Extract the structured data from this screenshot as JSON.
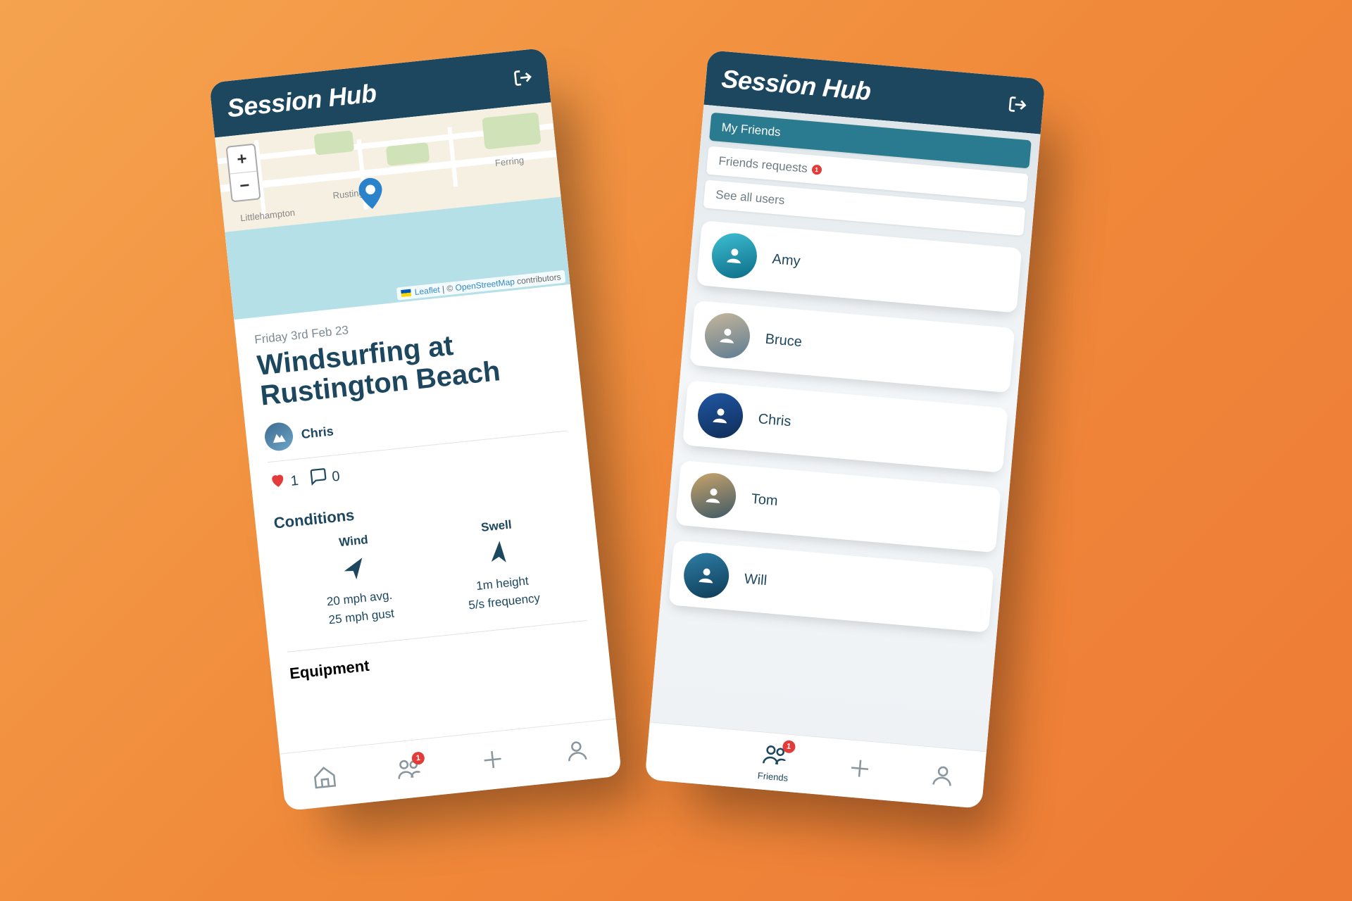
{
  "app": {
    "title": "Session Hub"
  },
  "map": {
    "zoom_in": "+",
    "zoom_out": "−",
    "labels": [
      "Littlehampton",
      "Rustington",
      "Ferring"
    ],
    "attribution": {
      "leaflet": "Leaflet",
      "sep": " | © ",
      "osm": "OpenStreetMap",
      "tail": " contributors"
    }
  },
  "session": {
    "date": "Friday 3rd Feb 23",
    "title": "Windsurfing at Rustington Beach",
    "author": "Chris",
    "likes": "1",
    "comments": "0",
    "conditions_heading": "Conditions",
    "wind": {
      "label": "Wind",
      "line1": "20 mph avg.",
      "line2": "25 mph gust"
    },
    "swell": {
      "label": "Swell",
      "line1": "1m height",
      "line2": "5/s frequency"
    },
    "equipment_heading": "Equipment"
  },
  "friends": {
    "tabs": {
      "my_friends": "My Friends",
      "requests": "Friends requests",
      "requests_badge": "1",
      "all_users": "See all users"
    },
    "list": [
      {
        "name": "Amy"
      },
      {
        "name": "Bruce"
      },
      {
        "name": "Chris"
      },
      {
        "name": "Tom"
      },
      {
        "name": "Will"
      }
    ]
  },
  "nav": {
    "friends_label": "Friends",
    "friends_badge": "1"
  }
}
